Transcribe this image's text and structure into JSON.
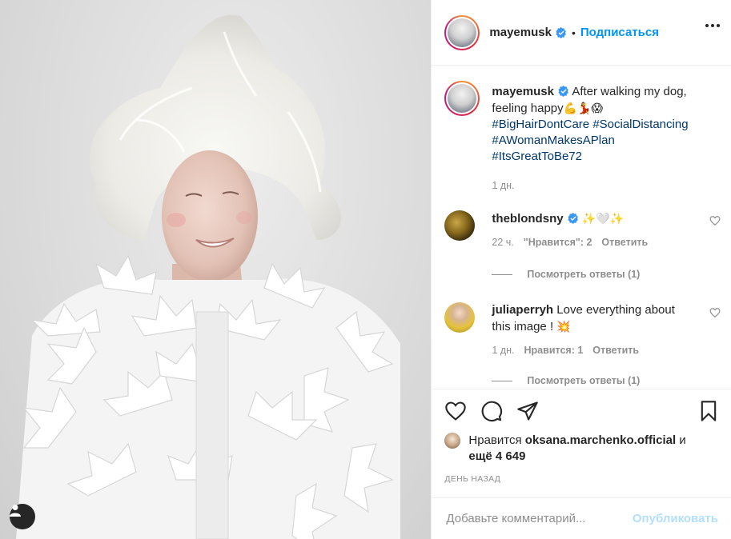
{
  "header": {
    "username": "mayemusk",
    "separator": "•",
    "follow_label": "Подписаться"
  },
  "caption": {
    "username": "mayemusk",
    "text": "After walking my dog, feeling happy",
    "emojis": "💪💃😱",
    "hashtags": [
      "#BigHairDontCare",
      "#SocialDistancing",
      "#AWomanMakesAPlan",
      "#ItsGreatToBe72"
    ],
    "time": "1 дн."
  },
  "comments": [
    {
      "username": "theblondsny",
      "verified": true,
      "text": "✨🤍✨",
      "time": "22 ч.",
      "likes_label": "\"Нравится\": 2",
      "reply_label": "Ответить",
      "view_replies": "Посмотреть ответы (1)"
    },
    {
      "username": "juliaperryh",
      "verified": false,
      "text": "Love everything about this image !",
      "emoji": "💥",
      "time": "1 дн.",
      "likes_label": "Нравится: 1",
      "reply_label": "Ответить",
      "view_replies": "Посмотреть ответы (1)"
    }
  ],
  "likes": {
    "prefix": "Нравится",
    "liker": "oksana.marchenko.official",
    "and": "и",
    "more": "ещё 4 649"
  },
  "date_label": "ДЕНЬ НАЗАД",
  "comment_box": {
    "placeholder": "Добавьте комментарий...",
    "publish_label": "Опубликовать"
  },
  "icons": {
    "verified": "verified-badge-icon",
    "more": "more-options-icon",
    "like": "heart-icon",
    "comment": "comment-icon",
    "share": "paper-plane-icon",
    "save": "bookmark-icon",
    "user_tags": "user-icon"
  },
  "colors": {
    "accent_blue": "#0095f6",
    "hashtag": "#00376b",
    "muted": "#8e8e8e",
    "publish_disabled": "#b2dffc"
  }
}
